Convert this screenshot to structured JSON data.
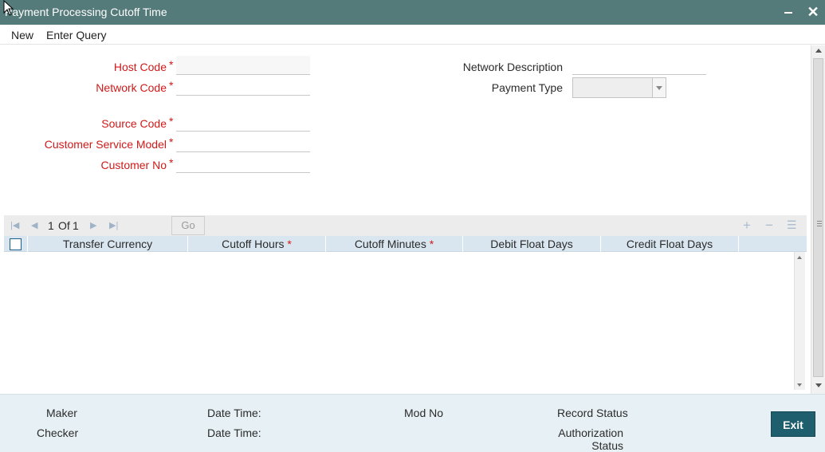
{
  "window": {
    "title": "Payment Processing Cutoff Time",
    "minimize_icon": "minimize-icon",
    "close_icon": "close-icon"
  },
  "menu": {
    "new": "New",
    "enter_query": "Enter Query"
  },
  "form": {
    "host_code": {
      "label": "Host Code",
      "value": ""
    },
    "network_code": {
      "label": "Network Code",
      "value": ""
    },
    "source_code": {
      "label": "Source Code",
      "value": ""
    },
    "customer_service_model": {
      "label": "Customer Service Model",
      "value": ""
    },
    "customer_no": {
      "label": "Customer No",
      "value": ""
    },
    "network_description": {
      "label": "Network Description",
      "value": ""
    },
    "payment_type": {
      "label": "Payment Type",
      "value": ""
    },
    "required_mark": "*"
  },
  "grid": {
    "pager": {
      "current": "1",
      "of_label": "Of",
      "total": "1"
    },
    "go_label": "Go",
    "columns": [
      {
        "label": "Transfer Currency",
        "required": false
      },
      {
        "label": "Cutoff Hours",
        "required": true
      },
      {
        "label": "Cutoff Minutes",
        "required": true
      },
      {
        "label": "Debit Float Days",
        "required": false
      },
      {
        "label": "Credit Float Days",
        "required": false
      }
    ],
    "required_mark": "*",
    "rows": []
  },
  "footer": {
    "maker": "Maker",
    "checker": "Checker",
    "date_time_1": "Date Time:",
    "date_time_2": "Date Time:",
    "mod_no": "Mod No",
    "record_status": "Record Status",
    "authorization_status_line1": "Authorization",
    "authorization_status_line2": "Status",
    "exit": "Exit"
  },
  "colors": {
    "titlebar": "#557a7a",
    "required_label": "#d01919",
    "grid_header": "#d9e6ef",
    "footer_bg": "#e7f0f4",
    "exit_button": "#1f5e6c"
  }
}
